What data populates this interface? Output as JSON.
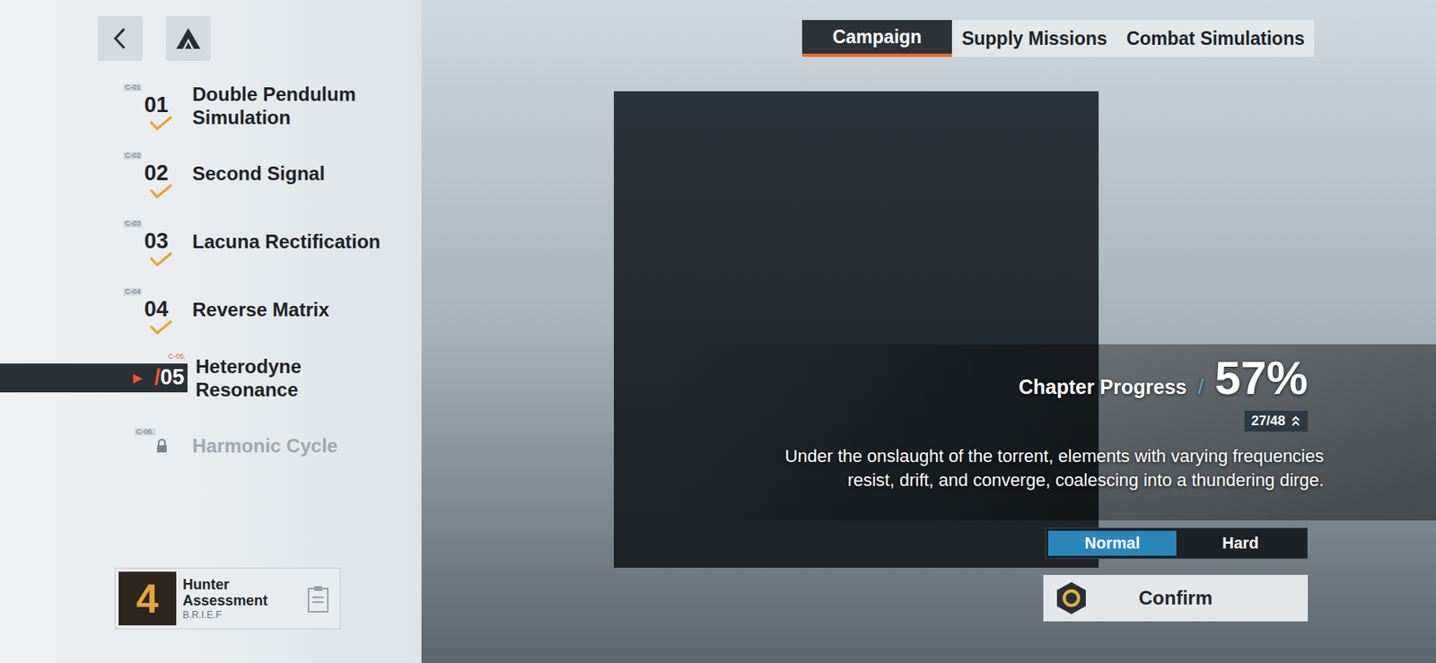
{
  "chapters": [
    {
      "code": "C-01",
      "number": "01",
      "title_lines": [
        "Double Pendulum",
        "Simulation"
      ],
      "completed": true,
      "selected": false,
      "locked": false
    },
    {
      "code": "C-02",
      "number": "02",
      "title_lines": [
        "Second Signal"
      ],
      "completed": true,
      "selected": false,
      "locked": false
    },
    {
      "code": "C-03",
      "number": "03",
      "title_lines": [
        "Lacuna Rectification"
      ],
      "completed": true,
      "selected": false,
      "locked": false
    },
    {
      "code": "C-04",
      "number": "04",
      "title_lines": [
        "Reverse Matrix"
      ],
      "completed": true,
      "selected": false,
      "locked": false
    },
    {
      "code": "C-05.",
      "number": "05",
      "title_lines": [
        "Heterodyne",
        "Resonance"
      ],
      "completed": false,
      "selected": true,
      "locked": false
    },
    {
      "code": "C-06.",
      "title_lines": [
        "Harmonic Cycle"
      ],
      "completed": false,
      "selected": false,
      "locked": true
    }
  ],
  "current_marker": {
    "arrow": "▶",
    "slash": "/"
  },
  "assessment": {
    "badge": "4",
    "title": "Hunter Assessment",
    "subtitle": "B.R.I.E.F"
  },
  "tabs": [
    {
      "label": "Campaign",
      "selected": true
    },
    {
      "label": "Supply Missions",
      "selected": false
    },
    {
      "label": "Combat Simulations",
      "selected": false
    }
  ],
  "progress": {
    "label": "Chapter Progress",
    "separator": "/",
    "percent": "57%",
    "count": "27/48"
  },
  "description": [
    "Under the onslaught of the torrent, elements with varying frequencies",
    "resist, drift, and converge, coalescing into a thundering dirge."
  ],
  "difficulty": [
    {
      "label": "Normal",
      "selected": true
    },
    {
      "label": "Hard",
      "selected": false
    }
  ],
  "confirm": {
    "label": "Confirm"
  }
}
